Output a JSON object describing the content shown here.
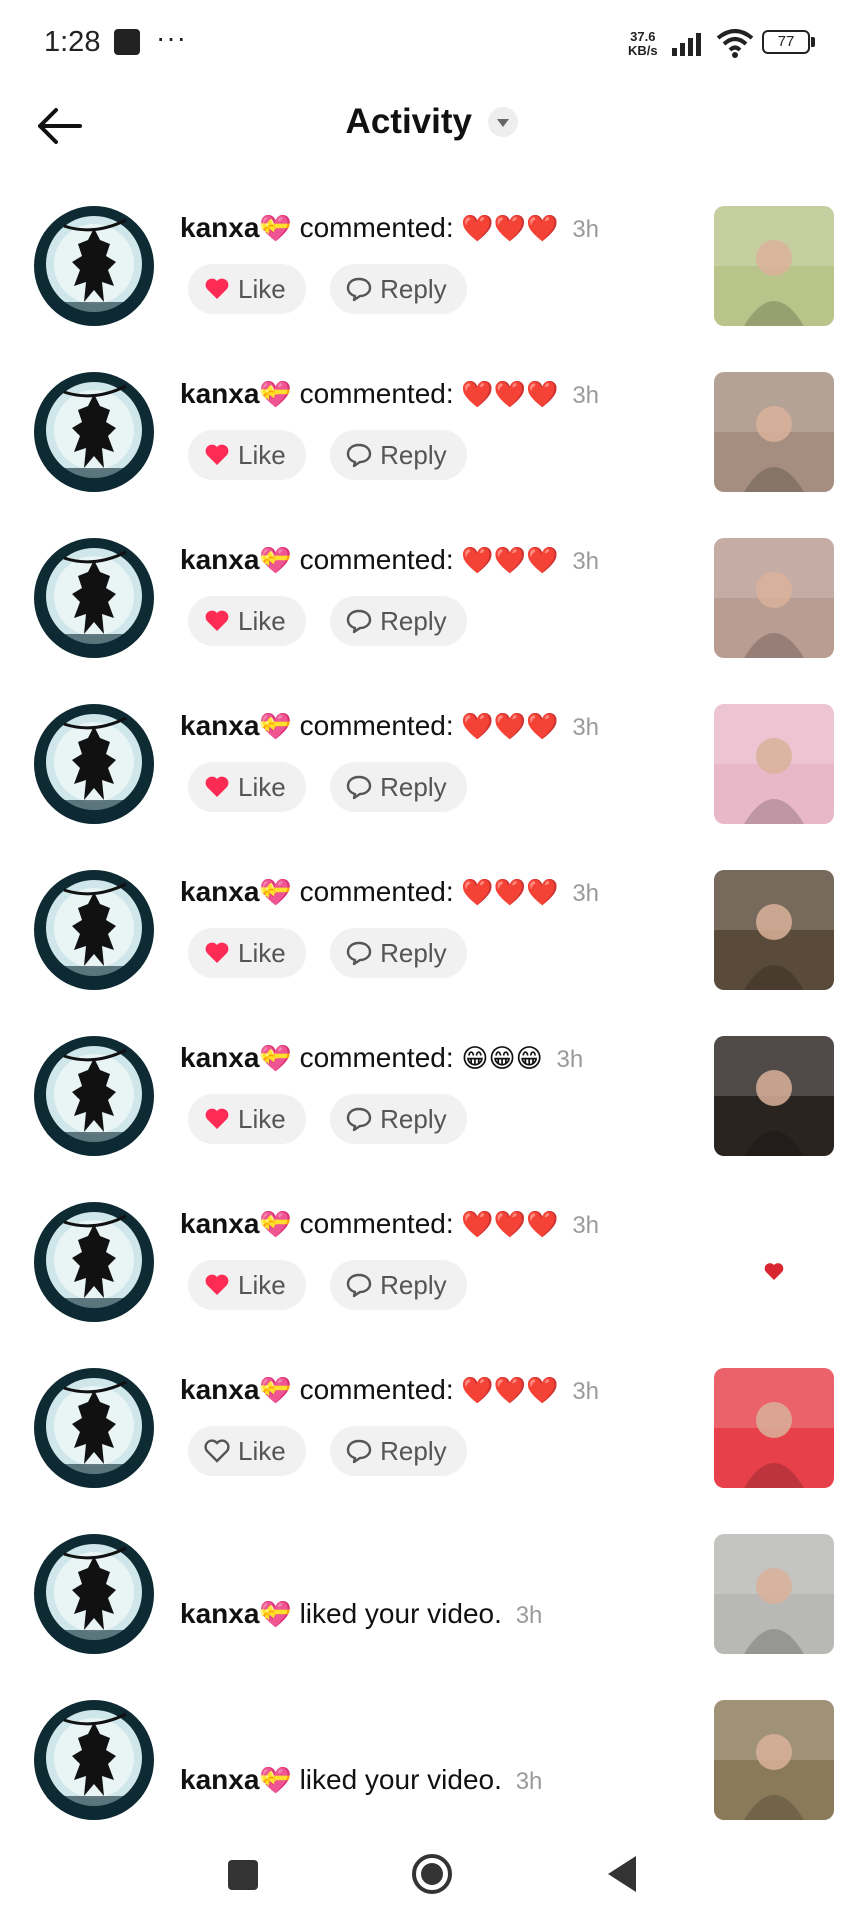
{
  "status_bar": {
    "time": "1:28",
    "dots": "···",
    "net_speed_value": "37.6",
    "net_speed_unit": "KB/s",
    "battery": "77"
  },
  "header": {
    "title": "Activity"
  },
  "activity_items": [
    {
      "username": "kanxa",
      "badge": "💝",
      "action": "commented:",
      "content": "❤️❤️❤️",
      "time": "3h",
      "like_label": "Like",
      "reply_label": "Reply",
      "liked": true,
      "thumb_color": "#b9c48a"
    },
    {
      "username": "kanxa",
      "badge": "💝",
      "action": "commented:",
      "content": "❤️❤️❤️",
      "time": "3h",
      "like_label": "Like",
      "reply_label": "Reply",
      "liked": true,
      "thumb_color": "#a58e7f"
    },
    {
      "username": "kanxa",
      "badge": "💝",
      "action": "commented:",
      "content": "❤️❤️❤️",
      "time": "3h",
      "like_label": "Like",
      "reply_label": "Reply",
      "liked": true,
      "thumb_color": "#b99c92"
    },
    {
      "username": "kanxa",
      "badge": "💝",
      "action": "commented:",
      "content": "❤️❤️❤️",
      "time": "3h",
      "like_label": "Like",
      "reply_label": "Reply",
      "liked": true,
      "thumb_color": "#e8b8c8"
    },
    {
      "username": "kanxa",
      "badge": "💝",
      "action": "commented:",
      "content": "❤️❤️❤️",
      "time": "3h",
      "like_label": "Like",
      "reply_label": "Reply",
      "liked": true,
      "thumb_color": "#5a4a3a"
    },
    {
      "username": "kanxa",
      "badge": "💝",
      "action": "commented:",
      "content": "😁😁😁",
      "time": "3h",
      "like_label": "Like",
      "reply_label": "Reply",
      "liked": true,
      "thumb_color": "#2a2420"
    },
    {
      "username": "kanxa",
      "badge": "💝",
      "action": "commented:",
      "content": "❤️❤️❤️",
      "time": "3h",
      "like_label": "Like",
      "reply_label": "Reply",
      "liked": true,
      "thumb_color": "#ffffff"
    },
    {
      "username": "kanxa",
      "badge": "💝",
      "action": "commented:",
      "content": "❤️❤️❤️",
      "time": "3h",
      "like_label": "Like",
      "reply_label": "Reply",
      "liked": false,
      "thumb_color": "#e8404a"
    },
    {
      "username": "kanxa",
      "badge": "💝",
      "action": "liked your video.",
      "content": "",
      "time": "3h",
      "thumb_color": "#b8b8b4"
    },
    {
      "username": "kanxa",
      "badge": "💝",
      "action": "liked your video.",
      "content": "",
      "time": "3h",
      "thumb_color": "#8a7a5a"
    }
  ]
}
